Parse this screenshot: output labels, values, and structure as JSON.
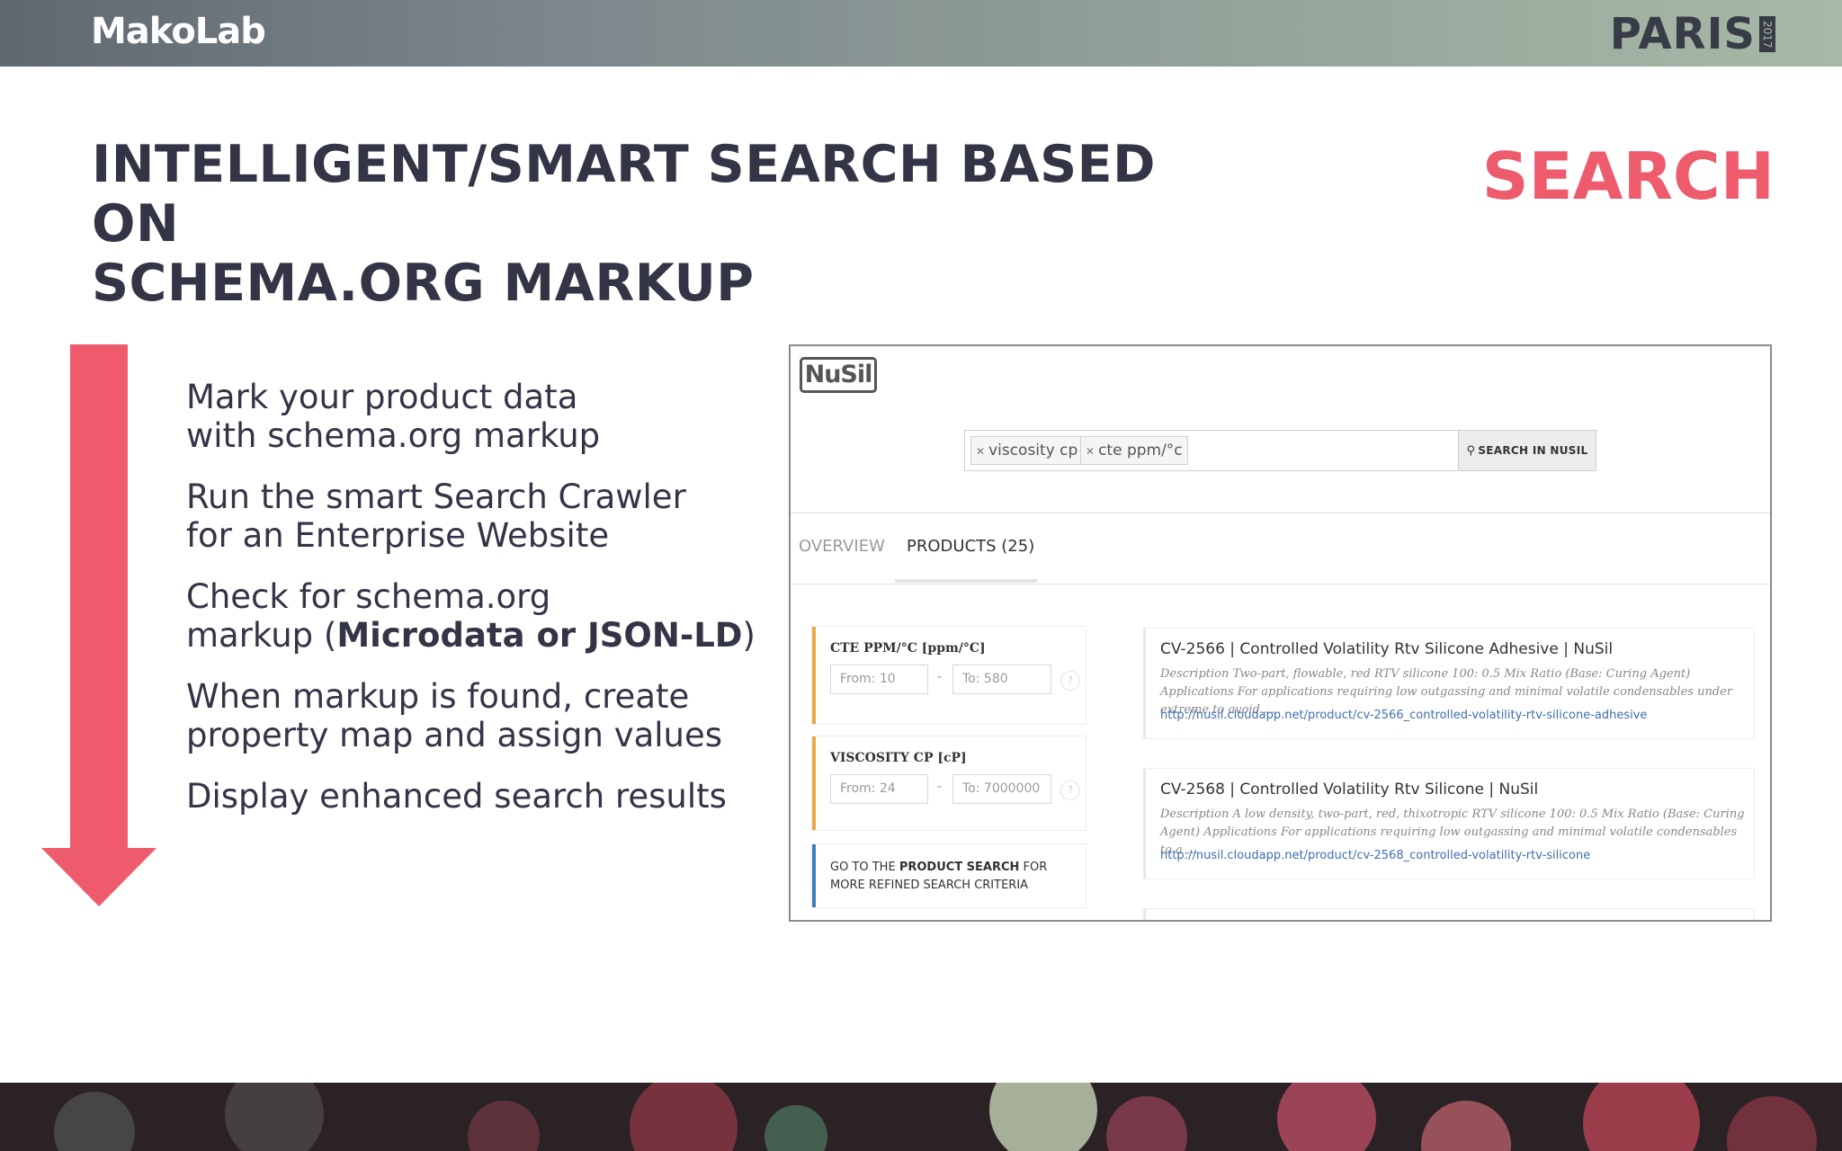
{
  "header": {
    "brand": "MakoLab",
    "event": "PARIS",
    "event_year": "2017"
  },
  "slide": {
    "title_line1": "INTELLIGENT/SMART SEARCH BASED ON",
    "title_line2": "SCHEMA.ORG MARKUP",
    "section": "SEARCH",
    "steps": [
      {
        "line1": "Mark your product data",
        "line2": "with schema.org markup"
      },
      {
        "line1": "Run the smart Search Crawler",
        "line2": "for an Enterprise Website"
      },
      {
        "line1": "Check for schema.org",
        "line2_pre": "markup (",
        "line2_bold": "Microdata or JSON-LD",
        "line2_post": ")"
      },
      {
        "line1": "When markup is found, create",
        "line2": "property map and assign values"
      },
      {
        "line1": "Display enhanced search results"
      }
    ]
  },
  "screenshot": {
    "logo": "NuSil",
    "search": {
      "chips": [
        "viscosity cp",
        "cte ppm/°c"
      ],
      "button_label": "SEARCH IN NUSIL"
    },
    "tabs": [
      "OVERVIEW",
      "PRODUCTS (25)"
    ],
    "filters": [
      {
        "title": "CTE PPM/°C [ppm/°C]",
        "from": "From: 10",
        "to": "To: 580"
      },
      {
        "title": "VISCOSITY CP [cP]",
        "from": "From: 24",
        "to": "To: 7000000"
      }
    ],
    "goto": {
      "pre": "GO TO THE ",
      "bold": "PRODUCT SEARCH",
      "post": " FOR MORE REFINED SEARCH CRITERIA"
    },
    "results": [
      {
        "title": "CV-2566 | Controlled Volatility Rtv Silicone Adhesive | NuSil",
        "desc": "Description Two-part, flowable, red RTV silicone 100: 0.5 Mix Ratio (Base: Curing Agent) Applications For applications requiring low outgassing and minimal volatile condensables under extreme to avoid ...",
        "url": "http://nusil.cloudapp.net/product/cv-2566_controlled-volatility-rtv-silicone-adhesive"
      },
      {
        "title": "CV-2568 | Controlled Volatility Rtv Silicone | NuSil",
        "desc": "Description A low density, two-part, red, thixotropic RTV silicone 100: 0.5 Mix Ratio (Base: Curing Agent) Applications For applications requiring low outgassing and minimal volatile condensables to a ...",
        "url": "http://nusil.cloudapp.net/product/cv-2568_controlled-volatility-rtv-silicone"
      }
    ]
  },
  "colors": {
    "accent": "#ee5b6d",
    "text": "#343447",
    "filter_bar": "#e9a94a",
    "goto_bar": "#3f7ec3",
    "link": "#3e6fb0"
  },
  "icons": [
    "down-arrow-icon",
    "close-icon",
    "search-icon",
    "help-icon"
  ]
}
